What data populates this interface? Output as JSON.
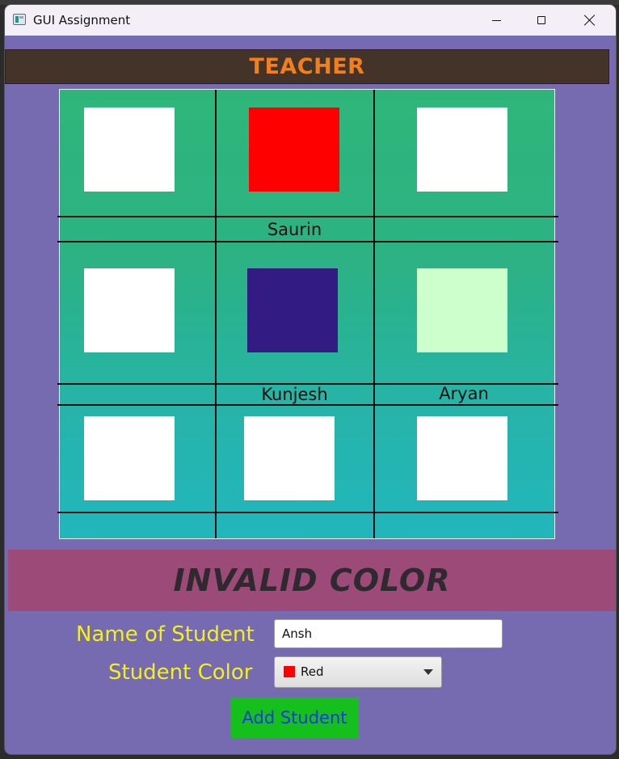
{
  "window": {
    "title": "GUI Assignment"
  },
  "teacher": {
    "label": "TEACHER"
  },
  "seats": [
    {
      "color": "#ffffff",
      "name": ""
    },
    {
      "color": "#ff0000",
      "name": "Saurin"
    },
    {
      "color": "#ffffff",
      "name": ""
    },
    {
      "color": "#ffffff",
      "name": ""
    },
    {
      "color": "#321b83",
      "name": "Kunjesh"
    },
    {
      "color": "#ccffcc",
      "name": "Aryan"
    },
    {
      "color": "#ffffff",
      "name": ""
    },
    {
      "color": "#ffffff",
      "name": ""
    },
    {
      "color": "#ffffff",
      "name": ""
    }
  ],
  "status": {
    "message": "INVALID COLOR"
  },
  "form": {
    "name_label": "Name of Student",
    "name_value": "Ansh",
    "color_label": "Student Color",
    "color_value": "Red",
    "color_swatch": "#ff0000",
    "add_button": "Add Student"
  }
}
